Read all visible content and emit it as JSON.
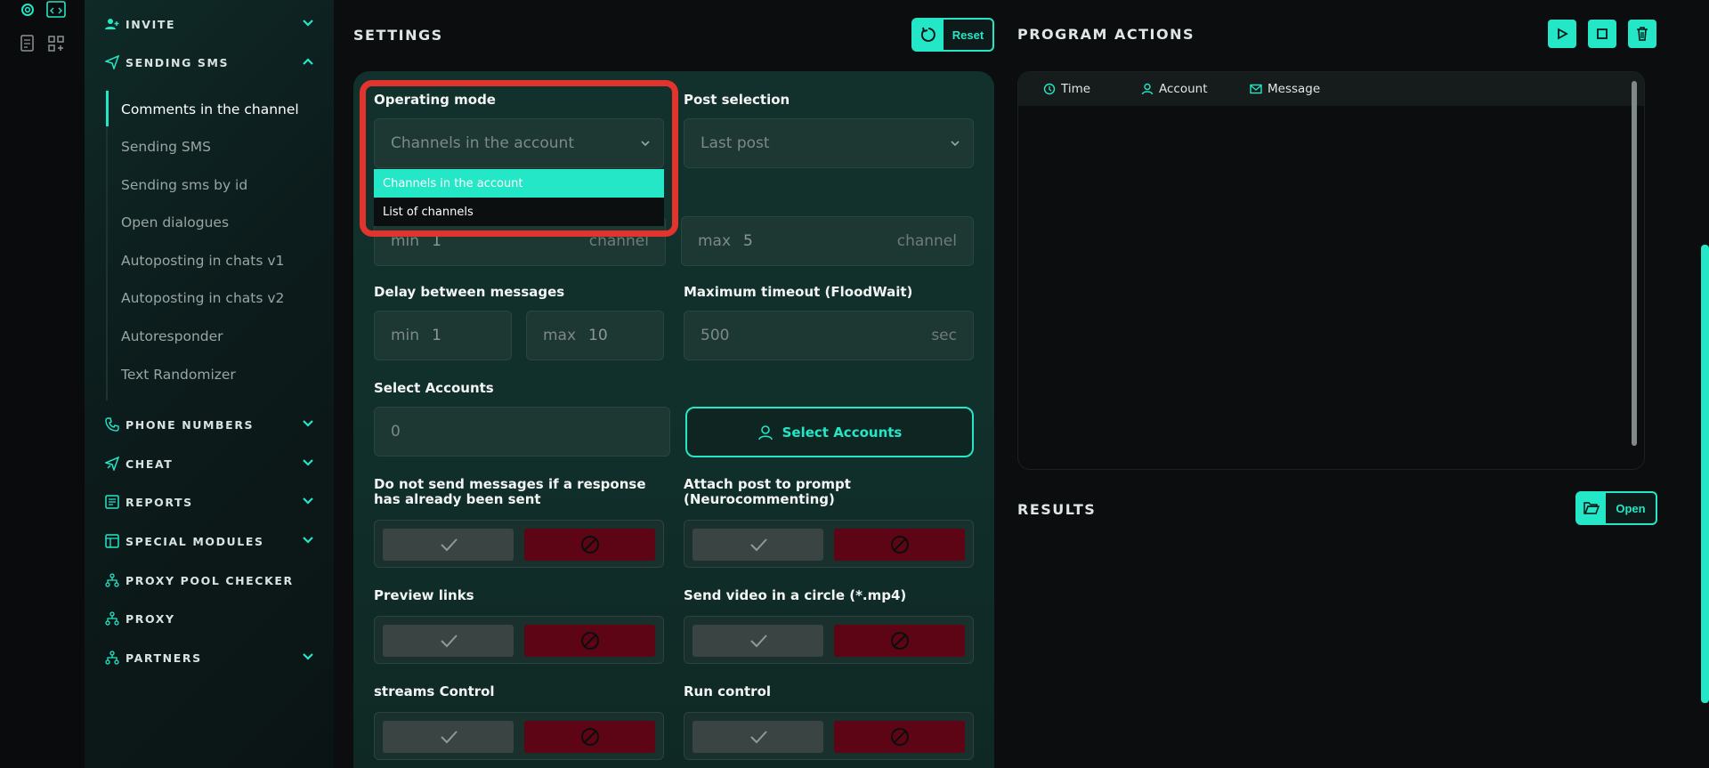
{
  "sidebar": {
    "sections": [
      {
        "title": "INVITE",
        "icon": "user-plus-icon",
        "expanded": false
      },
      {
        "title": "SENDING SMS",
        "icon": "send-icon",
        "expanded": true
      },
      {
        "title": "PHONE NUMBERS",
        "icon": "phone-icon",
        "expanded": false
      },
      {
        "title": "CHEAT",
        "icon": "boost-icon",
        "expanded": false
      },
      {
        "title": "REPORTS",
        "icon": "report-icon",
        "expanded": false
      },
      {
        "title": "SPECIAL MODULES",
        "icon": "modules-icon",
        "expanded": false
      },
      {
        "title": "PROXY POOL CHECKER",
        "icon": "network-icon",
        "expanded": null
      },
      {
        "title": "PROXY",
        "icon": "network-icon",
        "expanded": null
      },
      {
        "title": "PARTNERS",
        "icon": "network-icon",
        "expanded": false
      }
    ],
    "sending_sms_items": [
      {
        "label": "Comments in the channel",
        "active": true
      },
      {
        "label": "Sending SMS"
      },
      {
        "label": "Sending sms by id"
      },
      {
        "label": "Open dialogues"
      },
      {
        "label": "Autoposting in chats v1"
      },
      {
        "label": "Autoposting in chats v2"
      },
      {
        "label": "Autoresponder"
      },
      {
        "label": "Text Randomizer"
      }
    ]
  },
  "settings": {
    "title": "SETTINGS",
    "reset_label": "Reset",
    "operating_mode": {
      "label": "Operating mode",
      "value": "Channels in the account",
      "options": [
        "Channels in the account",
        "List of channels"
      ]
    },
    "post_selection": {
      "label": "Post selection",
      "value": "Last post"
    },
    "channels_range": {
      "min_label": "min",
      "min_value": "1",
      "max_label": "max",
      "max_value": "5",
      "unit": "channel"
    },
    "delay": {
      "label": "Delay between messages",
      "min_label": "min",
      "min_value": "1",
      "max_label": "max",
      "max_value": "10"
    },
    "timeout": {
      "label": "Maximum timeout (FloodWait)",
      "value": "500",
      "unit": "sec"
    },
    "select_accounts": {
      "label": "Select Accounts",
      "value": "0",
      "button_label": "Select Accounts"
    },
    "toggles": [
      {
        "label": "Do not send messages if a response has already been sent"
      },
      {
        "label": "Attach post to prompt (Neurocommenting)"
      },
      {
        "label": "Preview links"
      },
      {
        "label": "Send video in a circle (*.mp4)"
      },
      {
        "label": "streams Control"
      },
      {
        "label": "Run control"
      }
    ]
  },
  "program_actions": {
    "title": "PROGRAM ACTIONS",
    "columns": [
      "Time",
      "Account",
      "Message"
    ]
  },
  "results": {
    "title": "RESULTS",
    "open_label": "Open"
  },
  "colors": {
    "accent": "#23e7c6",
    "danger": "#5e0515",
    "highlight": "#e0342c"
  }
}
